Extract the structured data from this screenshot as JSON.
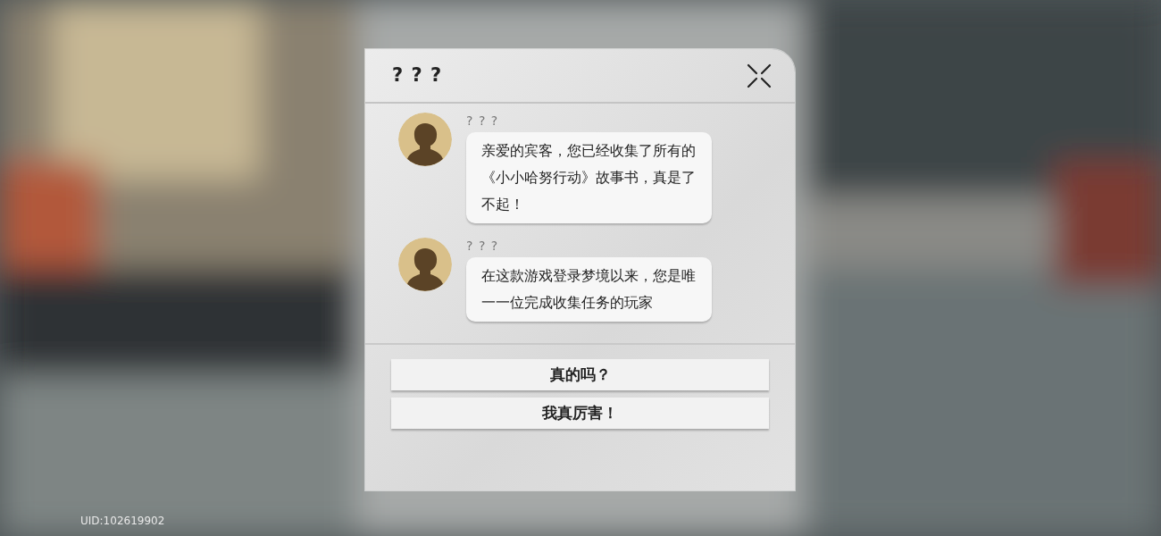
{
  "dialog": {
    "title": "? ? ?",
    "messages": [
      {
        "speaker": "? ? ?",
        "text": "亲爱的宾客，您已经收集了所有的《小小哈努行动》故事书，真是了不起！"
      },
      {
        "speaker": "? ? ?",
        "text": "在这款游戏登录梦境以来，您是唯一一位完成收集任务的玩家"
      }
    ],
    "choices": [
      "真的吗？",
      "我真厉害！"
    ]
  },
  "uid": "UID:102619902"
}
